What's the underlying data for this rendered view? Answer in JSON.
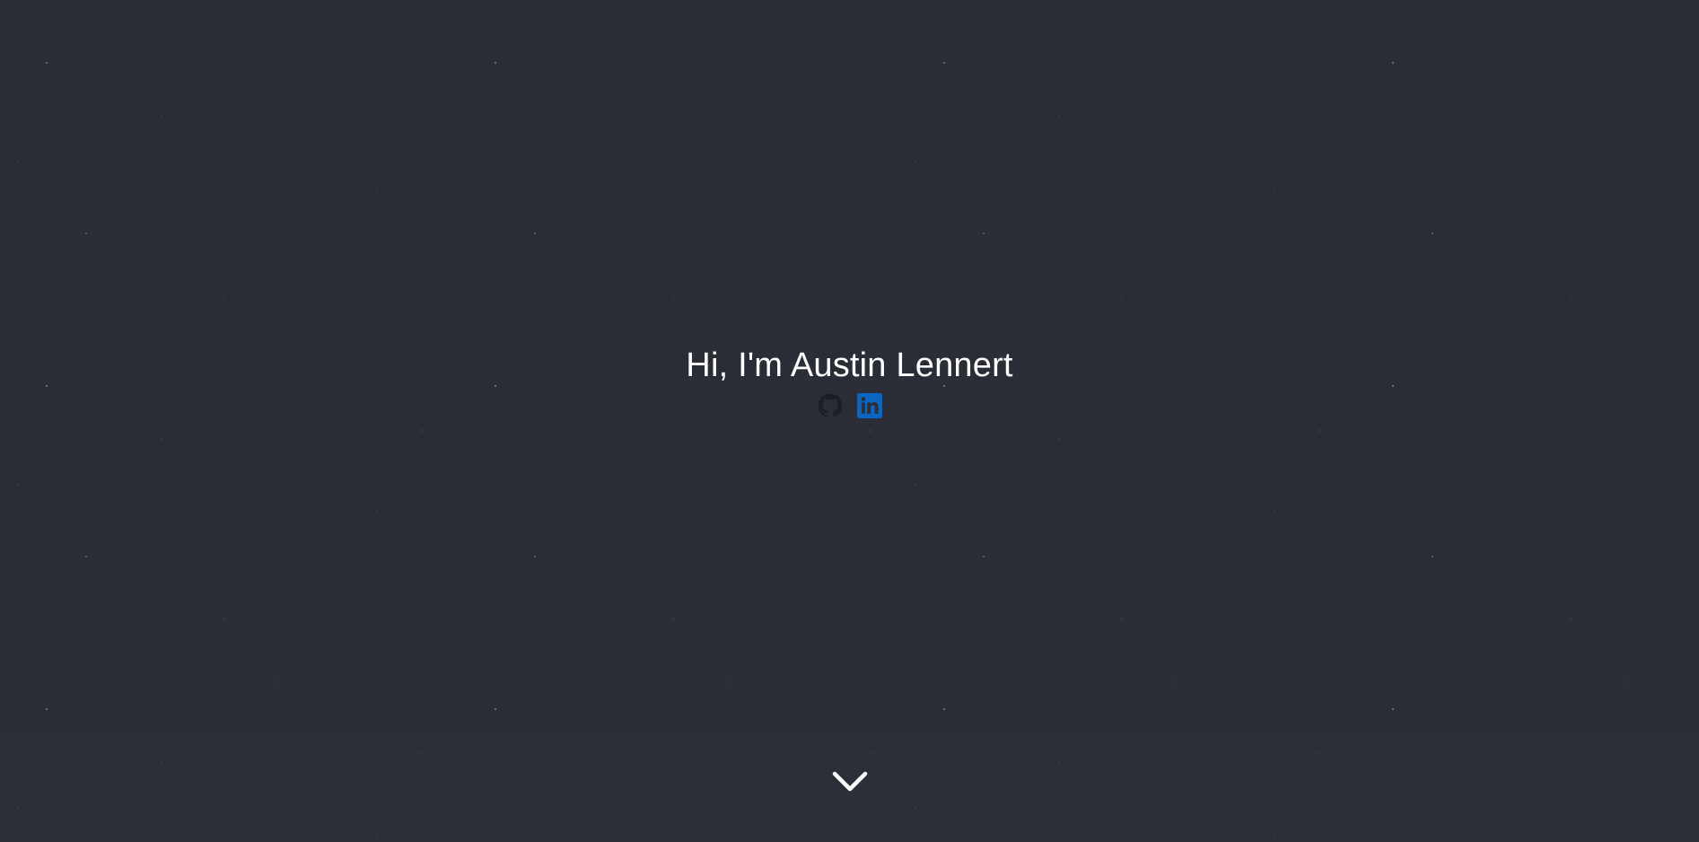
{
  "hero": {
    "title": "Hi, I'm Austin Lennert"
  },
  "social": [
    {
      "name": "github",
      "icon": "github-icon",
      "color": "#1b1f23"
    },
    {
      "name": "linkedin",
      "icon": "linkedin-icon",
      "color": "#0a66c2"
    }
  ],
  "scroll": {
    "icon": "chevron-down-icon",
    "color": "#ffffff"
  },
  "colors": {
    "background": "#2b2e36",
    "text": "#ffffff"
  }
}
